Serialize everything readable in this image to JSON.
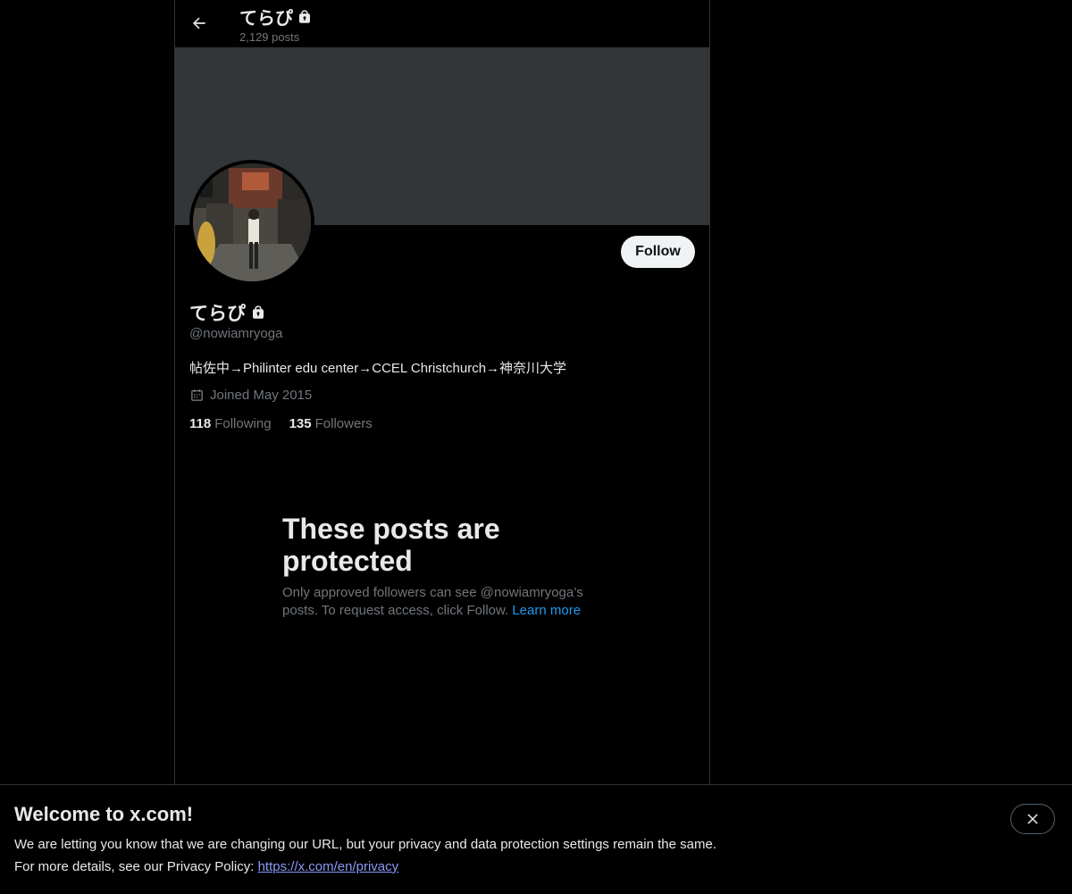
{
  "header": {
    "title": "てらぴ",
    "posts_count": "2,129 posts"
  },
  "profile": {
    "display_name": "てらぴ",
    "handle": "@nowiamryoga",
    "bio": "帖佐中→Philinter edu center→CCEL Christchurch→神奈川大学",
    "joined": "Joined May 2015",
    "following_count": "118",
    "following_label": "Following",
    "followers_count": "135",
    "followers_label": "Followers",
    "follow_button": "Follow"
  },
  "protected": {
    "heading": "These posts are protected",
    "body": "Only approved followers can see @nowiamryoga’s posts. To request access, click Follow. ",
    "learn_more": "Learn more"
  },
  "notice": {
    "title": "Welcome to x.com!",
    "line1": "We are letting you know that we are changing our URL, but your privacy and data protection settings remain the same.",
    "line2_prefix": "For more details, see our Privacy Policy: ",
    "link": "https://x.com/en/privacy"
  },
  "colors": {
    "background": "#000000",
    "banner": "#333639",
    "link": "#1d9bf0",
    "muted": "#71767b"
  },
  "icons": {
    "back": "arrow-left-icon",
    "lock": "lock-icon",
    "calendar": "calendar-icon",
    "close": "close-icon"
  }
}
